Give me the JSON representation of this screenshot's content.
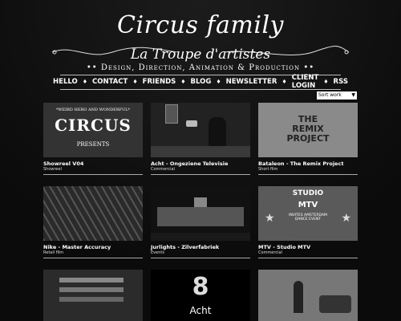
{
  "header": {
    "logo": "Circus family",
    "subtitle": "La Troupe d'artistes",
    "tagline": "•• Design, Direction, Animation & Production ••"
  },
  "nav": [
    "HELLO",
    "CONTACT",
    "FRIENDS",
    "BLOG",
    "NEWSLETTER",
    "CLIENT LOGIN",
    "RSS"
  ],
  "sort": {
    "label": "Sort work"
  },
  "items": [
    {
      "title": "Showreel V04",
      "category": "Showreel",
      "thumb_text": [
        "*WEIRD HERO AND WONDERFUL*",
        "CIRCUS",
        "PRESENTS"
      ]
    },
    {
      "title": "Acht - Ongeziene Televisie",
      "category": "Commercial",
      "thumb_text": []
    },
    {
      "title": "Bataleon - The Remix Project",
      "category": "Short film",
      "thumb_text": [
        "THE",
        "REMIX",
        "PROJECT"
      ]
    },
    {
      "title": "Nike - Master Accuracy",
      "category": "Retail film",
      "thumb_text": []
    },
    {
      "title": "Jurlights - Zilverfabriek",
      "category": "Events",
      "thumb_text": []
    },
    {
      "title": "MTV - Studio MTV",
      "category": "Commercial",
      "thumb_text": [
        "STUDIO",
        "MTV",
        "INVITES AMSTERDAM DANCE EVENT"
      ]
    },
    {
      "title": "",
      "category": "",
      "thumb_text": []
    },
    {
      "title": "",
      "category": "",
      "thumb_text": [
        "Acht"
      ]
    },
    {
      "title": "",
      "category": "",
      "thumb_text": []
    }
  ]
}
